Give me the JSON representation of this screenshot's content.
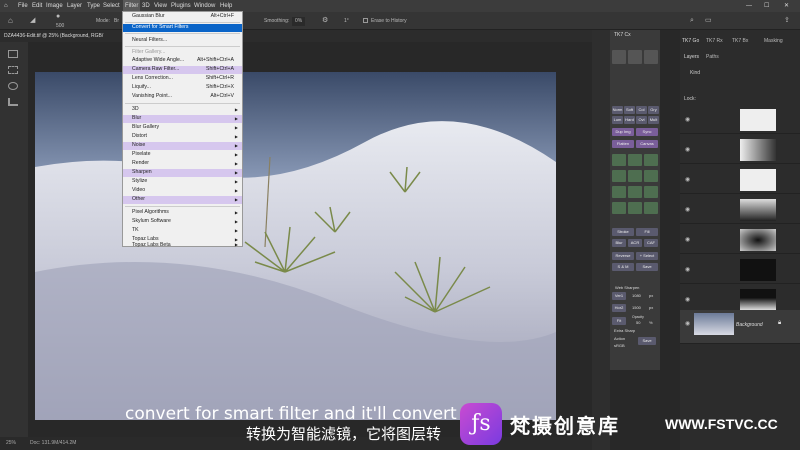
{
  "menubar": {
    "items": [
      "File",
      "Edit",
      "Image",
      "Layer",
      "Type",
      "Select",
      "Filter",
      "3D",
      "View",
      "Plugins",
      "Window",
      "Help"
    ]
  },
  "options": {
    "brush_size": "500",
    "mode_label": "Mode:",
    "mode_value": "Br",
    "smoothing_label": "Smoothing:",
    "smoothing_value": "0%",
    "angle": "1°",
    "erase_history": "Erase to History"
  },
  "document": {
    "tab_title": "DZA4436-Edit.tif @ 25% (Background, RGB/"
  },
  "status": {
    "zoom": "25%",
    "doc_info": "Doc: 131.9M/414.2M"
  },
  "filter_menu": {
    "items": [
      {
        "label": "Gaussian Blur",
        "shortcut": "Alt+Ctrl+F"
      },
      {
        "label": "Convert for Smart Filters",
        "shortcut": ""
      },
      {
        "label": "Neural Filters...",
        "shortcut": ""
      },
      {
        "label": "Filter Gallery...",
        "shortcut": ""
      },
      {
        "label": "Adaptive Wide Angle...",
        "shortcut": "Alt+Shift+Ctrl+A"
      },
      {
        "label": "Camera Raw Filter...",
        "shortcut": "Shift+Ctrl+A"
      },
      {
        "label": "Lens Correction...",
        "shortcut": "Shift+Ctrl+R"
      },
      {
        "label": "Liquify...",
        "shortcut": "Shift+Ctrl+X"
      },
      {
        "label": "Vanishing Point...",
        "shortcut": "Alt+Ctrl+V"
      },
      {
        "label": "3D",
        "shortcut": ""
      },
      {
        "label": "Blur",
        "shortcut": ""
      },
      {
        "label": "Blur Gallery",
        "shortcut": ""
      },
      {
        "label": "Distort",
        "shortcut": ""
      },
      {
        "label": "Noise",
        "shortcut": ""
      },
      {
        "label": "Pixelate",
        "shortcut": ""
      },
      {
        "label": "Render",
        "shortcut": ""
      },
      {
        "label": "Sharpen",
        "shortcut": ""
      },
      {
        "label": "Stylize",
        "shortcut": ""
      },
      {
        "label": "Video",
        "shortcut": ""
      },
      {
        "label": "Other",
        "shortcut": ""
      },
      {
        "label": "Pixel Algorithms",
        "shortcut": ""
      },
      {
        "label": "Skylum Software",
        "shortcut": ""
      },
      {
        "label": "TK",
        "shortcut": ""
      },
      {
        "label": "Topaz Labs",
        "shortcut": ""
      },
      {
        "label": "Topaz Labs Beta",
        "shortcut": ""
      }
    ]
  },
  "tk7": {
    "tab": "TK7 Cx",
    "buttons": [
      "Norm",
      "Soft",
      "Col",
      "Gry",
      "Lum",
      "Hard",
      "Ovl",
      "Mult",
      "Dup Img",
      "Sync",
      "Flatten",
      "Canvas",
      "Stroke",
      "Fill",
      "Blur",
      "ACR",
      "CAF",
      "Reverse",
      "+ Select",
      "S & M",
      "Save",
      "Web Sharpen",
      "Ver1",
      "1080",
      "px",
      "Hor2",
      "1500",
      "px",
      "Fit",
      "Opacity",
      "50",
      "%",
      "Extra Sharp",
      "Action",
      "sRGB",
      "Save"
    ]
  },
  "layers_panel": {
    "tabs": [
      "TK7 Go",
      "TK7 Rx",
      "TK7 Bx",
      "Masking"
    ],
    "sub_tabs": [
      "Layers",
      "Paths"
    ],
    "kind": "Kind",
    "lock_label": "Lock:",
    "background_label": "Background"
  },
  "subtitles": {
    "en": "convert for smart filter and it'll convert t",
    "zh": "转换为智能滤镜，它将图层转"
  },
  "watermark": {
    "brand": "梵摄创意库",
    "url": "WWW.FSTVC.CC"
  },
  "colors": {
    "highlight": "#d6c7ee",
    "selected": "#0a64c8"
  }
}
